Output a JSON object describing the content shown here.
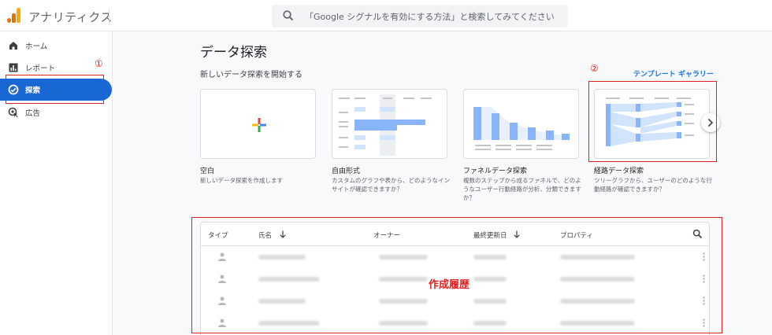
{
  "app": {
    "title": "アナリティクス"
  },
  "search": {
    "placeholder": "「Google シグナルを有効にする方法」と検索してみてください"
  },
  "sidebar": {
    "items": [
      {
        "label": "ホーム",
        "icon": "home-icon",
        "active": false
      },
      {
        "label": "レポート",
        "icon": "bar-chart-icon",
        "active": false
      },
      {
        "label": "探索",
        "icon": "explore-icon",
        "active": true
      },
      {
        "label": "広告",
        "icon": "ads-icon",
        "active": false
      }
    ]
  },
  "main": {
    "title": "データ探索",
    "start_section": "新しいデータ探索を開始する",
    "template_gallery_link": "テンプレート ギャラリー",
    "templates": [
      {
        "name": "空白",
        "desc": "新しいデータ探索を作成します"
      },
      {
        "name": "自由形式",
        "desc": "カスタムのグラフや表から、どのようなインサイトが確認できますか？"
      },
      {
        "name": "ファネルデータ探索",
        "desc": "複数のステップから成るファネルで、どのようなユーザー行動経路が分析、分類できますか？"
      },
      {
        "name": "経路データ探索",
        "desc": "ツリーグラフから、ユーザーのどのような行動経路が確認できますか？"
      }
    ],
    "table": {
      "columns": [
        "タイプ",
        "氏名",
        "オーナー",
        "最終更新日",
        "プロパティ"
      ],
      "row_count": 4
    }
  },
  "annotations": {
    "marker_1": "①",
    "marker_2": "②",
    "history_label": "作成履歴",
    "color": "#e02020"
  },
  "colors": {
    "accent": "#1967d2",
    "link": "#1a73e8",
    "chart_blue": "#8ab4f8"
  }
}
